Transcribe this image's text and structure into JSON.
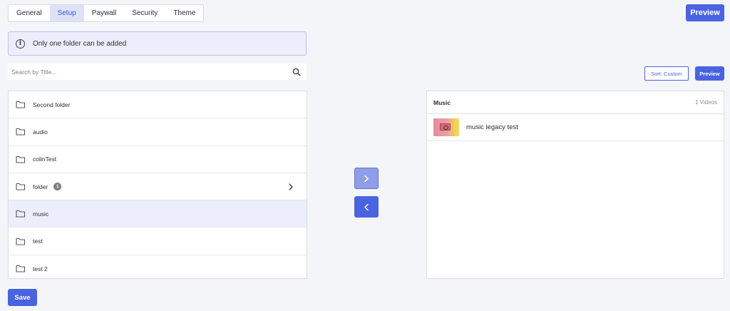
{
  "tabs": [
    {
      "label": "General"
    },
    {
      "label": "Setup"
    },
    {
      "label": "Paywall"
    },
    {
      "label": "Security"
    },
    {
      "label": "Theme"
    }
  ],
  "active_tab": "Setup",
  "header": {
    "preview_label": "Preview"
  },
  "info": {
    "icon": "info-icon",
    "text": "Only one folder can be added"
  },
  "search": {
    "placeholder": "Search by Title...",
    "value": ""
  },
  "toolbar": {
    "sort_label": "Sort: Custom",
    "preview_label": "Preview"
  },
  "folders": [
    {
      "label": "Second folder"
    },
    {
      "label": "audio"
    },
    {
      "label": "colinTest"
    },
    {
      "label": "folder",
      "badge": "1"
    },
    {
      "label": "music"
    },
    {
      "label": "test"
    },
    {
      "label": "test 2"
    }
  ],
  "selected_folder": "music",
  "playlist": {
    "title": "Music",
    "count": "1 Videos",
    "videos": [
      {
        "title": "music legacy test"
      }
    ]
  },
  "footer": {
    "save_label": "Save"
  },
  "colors": {
    "accent": "#4a63e0",
    "selected_bg": "#eceefb"
  }
}
